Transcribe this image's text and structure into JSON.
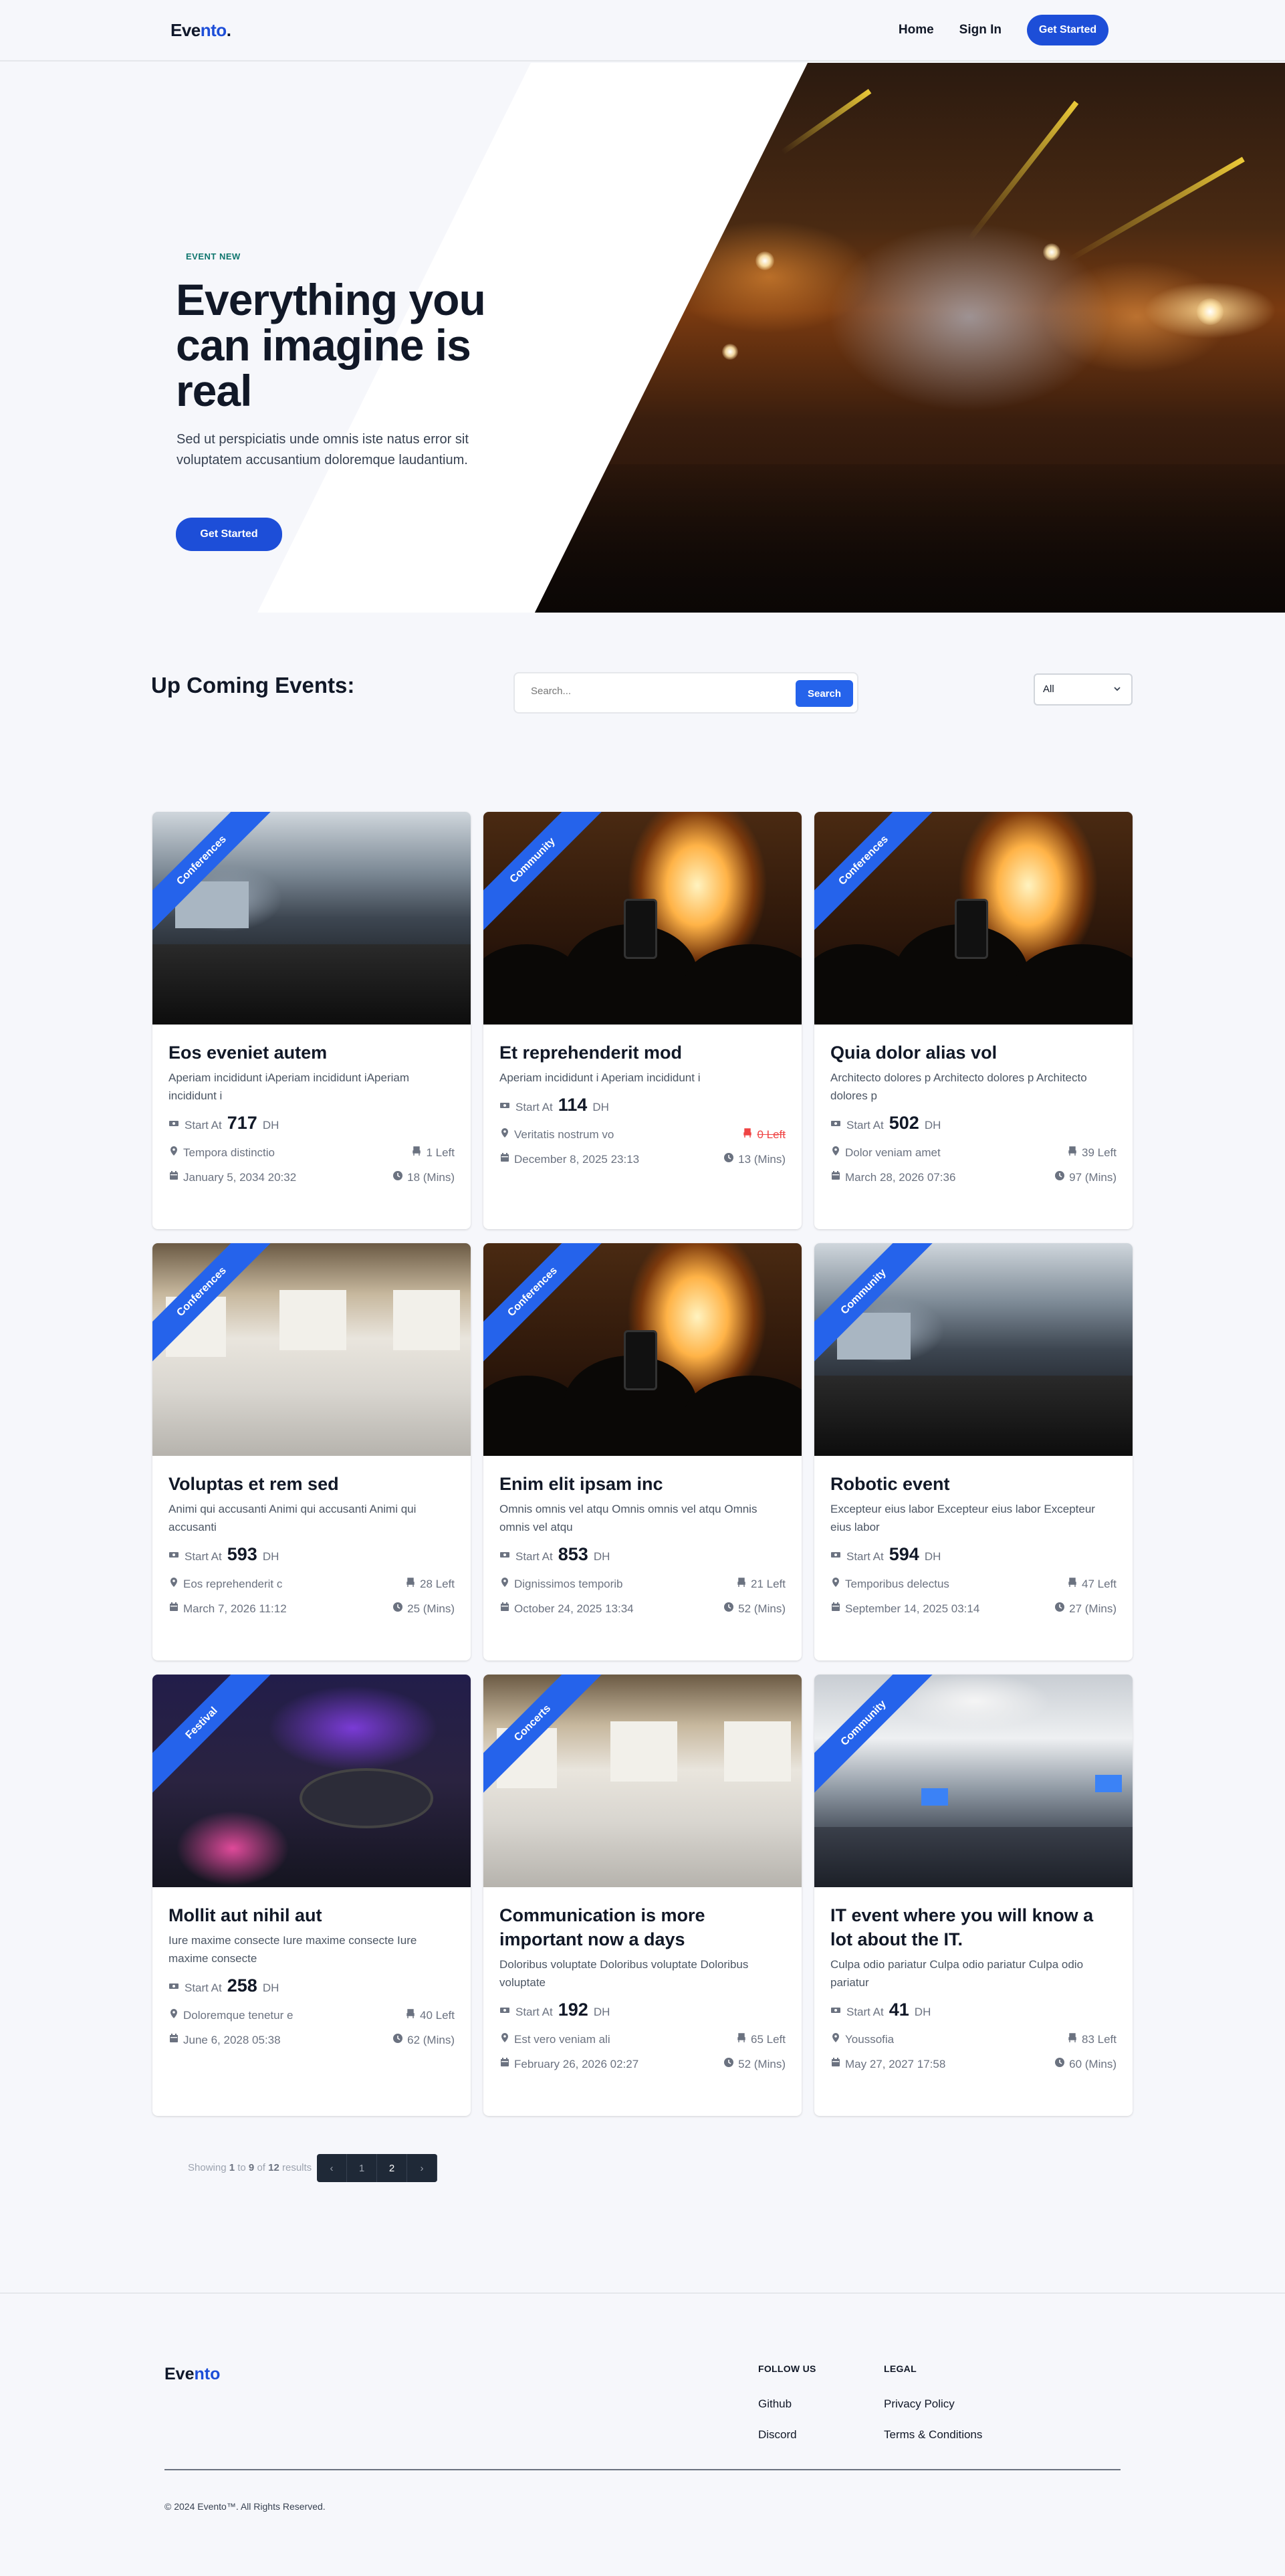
{
  "nav": {
    "logo_part1": "Eve",
    "logo_part2": "nto",
    "logo_dot": ".",
    "home": "Home",
    "sign_in": "Sign In",
    "get_started": "Get Started"
  },
  "hero": {
    "tag": "EVENT NEW",
    "title": "Everything you can imagine is real",
    "subtitle": "Sed ut perspiciatis unde omnis iste natus error sit voluptatem accusantium doloremque laudantium.",
    "cta": "Get Started"
  },
  "events": {
    "title": "Up Coming Events:",
    "search_placeholder": "Search...",
    "search_button": "Search",
    "filter_value": "All",
    "start_at_label": "Start At",
    "currency": "DH",
    "items": [
      {
        "category": "Conferences",
        "title": "Eos eveniet autem",
        "desc": "Aperiam incididunt iAperiam incididunt iAperiam incididunt i",
        "price": "717",
        "location": "Tempora distinctio",
        "left": "1 Left",
        "date": "January 5, 2034 20:32",
        "duration": "18 (Mins)",
        "image": "conference-crowd"
      },
      {
        "category": "Community",
        "title": "Et reprehenderit mod",
        "desc": "Aperiam incididunt i Aperiam incididunt i",
        "price": "114",
        "location": "Veritatis nostrum vo",
        "left": "0 Left",
        "date": "December 8, 2025 23:13",
        "duration": "13 (Mins)",
        "image": "concert-fire"
      },
      {
        "category": "Conferences",
        "title": "Quia dolor alias vol",
        "desc": "Architecto dolores p Architecto dolores p Architecto dolores p",
        "price": "502",
        "location": "Dolor veniam amet",
        "left": "39 Left",
        "date": "March 28, 2026 07:36",
        "duration": "97 (Mins)",
        "image": "concert-fire"
      },
      {
        "category": "Conferences",
        "title": "Voluptas et rem sed",
        "desc": "Animi qui accusanti Animi qui accusanti Animi qui accusanti",
        "price": "593",
        "location": "Eos reprehenderit c",
        "left": "28 Left",
        "date": "March 7, 2026 11:12",
        "duration": "25 (Mins)",
        "image": "banquet-hall"
      },
      {
        "category": "Conferences",
        "title": "Enim elit ipsam inc",
        "desc": "Omnis omnis vel atqu Omnis omnis vel atqu Omnis omnis vel atqu",
        "price": "853",
        "location": "Dignissimos temporib",
        "left": "21 Left",
        "date": "October 24, 2025 13:34",
        "duration": "52 (Mins)",
        "image": "concert-fire"
      },
      {
        "category": "Community",
        "title": "Robotic event",
        "desc": "Excepteur eius labor Excepteur eius labor Excepteur eius labor",
        "price": "594",
        "location": "Temporibus delectus",
        "left": "47 Left",
        "date": "September 14, 2025 03:14",
        "duration": "27 (Mins)",
        "image": "conference-crowd"
      },
      {
        "category": "Festival",
        "title": "Mollit aut nihil aut",
        "desc": "Iure maxime consecte Iure maxime consecte Iure maxime consecte",
        "price": "258",
        "location": "Doloremque tenetur e",
        "left": "40 Left",
        "date": "June 6, 2028 05:38",
        "duration": "62 (Mins)",
        "image": "dj-mixer"
      },
      {
        "category": "Concerts",
        "title": "Communication is more important now a days",
        "desc": "Doloribus voluptate Doloribus voluptate Doloribus voluptate",
        "price": "192",
        "location": "Est vero veniam ali",
        "left": "65 Left",
        "date": "February 26, 2026 02:27",
        "duration": "52 (Mins)",
        "image": "banquet-hall"
      },
      {
        "category": "Community",
        "title": "IT event where you will know a lot about the IT.",
        "desc": "Culpa odio pariatur Culpa odio pariatur Culpa odio pariatur",
        "price": "41",
        "location": "Youssofia",
        "left": "83 Left",
        "date": "May 27, 2027 17:58",
        "duration": "60 (Mins)",
        "image": "office-talk"
      }
    ]
  },
  "pagination": {
    "showing": "Showing",
    "from": "1",
    "to_word": "to",
    "to": "9",
    "of_word": "of",
    "total": "12",
    "results": "results",
    "prev": "‹",
    "page1": "1",
    "page2": "2",
    "next": "›"
  },
  "footer": {
    "logo_part1": "Eve",
    "logo_part2": "nto",
    "follow_us": "FOLLOW US",
    "github": "Github",
    "discord": "Discord",
    "legal": "LEGAL",
    "privacy": "Privacy Policy",
    "terms": "Terms & Conditions",
    "copyright": "© 2024 Evento™. All Rights Reserved."
  },
  "colors": {
    "accent": "#1d4ed8",
    "ribbon": "#2563eb",
    "danger": "#ef4444",
    "text_dark": "#111827"
  }
}
